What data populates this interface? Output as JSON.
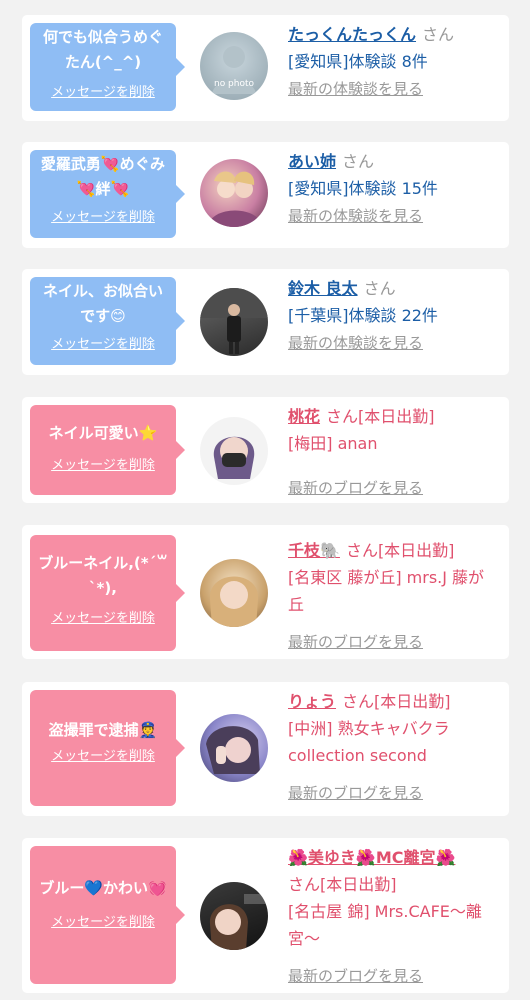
{
  "entries": [
    {
      "message": "何でも似合うめぐたん(^_^)",
      "delete_label": "メッセージを削除",
      "name": "たっくんたっくん",
      "suffix": "さん",
      "meta": "[愛知県]体験談 8件",
      "link": "最新の体験談を見る",
      "avatar": "no-photo",
      "nophoto_text": "no photo"
    },
    {
      "message": "愛羅武勇💘めぐみ💘絆💘",
      "delete_label": "メッセージを削除",
      "name": "あい姉",
      "suffix": "さん",
      "meta": "[愛知県]体験談 15件",
      "link": "最新の体験談を見る",
      "avatar": "photo"
    },
    {
      "message": "ネイル、お似合いです😊",
      "delete_label": "メッセージを削除",
      "name": "鈴木 良太",
      "suffix": "さん",
      "meta": "[千葉県]体験談 22件",
      "link": "最新の体験談を見る",
      "avatar": "photo"
    },
    {
      "message": "ネイル可愛い⭐",
      "delete_label": "メッセージを削除",
      "name": "桃花",
      "suffix": "さん[本日出勤]",
      "meta": "[梅田] anan",
      "link": "最新のブログを見る",
      "avatar": "photo"
    },
    {
      "message": "ブルーネイル,(*´꒳`*),",
      "delete_label": "メッセージを削除",
      "name": "千枝🐘",
      "suffix": "さん[本日出勤]",
      "meta": "[名東区 藤が丘] mrs.J 藤が丘",
      "link": "最新のブログを見る",
      "avatar": "photo"
    },
    {
      "message": "盗撮罪で逮捕👮",
      "delete_label": "メッセージを削除",
      "name": "りょう",
      "suffix": "さん[本日出勤]",
      "meta": "[中洲] 熟女キャバクラ collection second",
      "link": "最新のブログを見る",
      "avatar": "photo"
    },
    {
      "message": "ブルー💙かわい💓",
      "delete_label": "メッセージを削除",
      "name": "🌺美ゆき🌺MC離宮🌺",
      "suffix": "さん[本日出勤]",
      "meta": "[名古屋 錦] Mrs.CAFE〜離宮〜",
      "link": "最新のブログを見る",
      "avatar": "photo"
    }
  ]
}
